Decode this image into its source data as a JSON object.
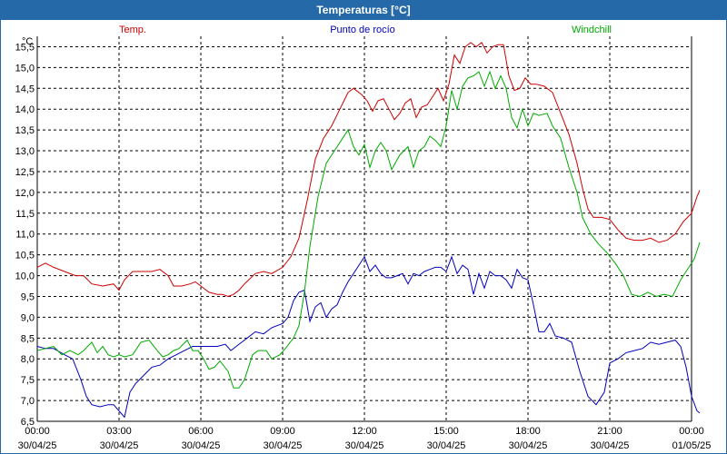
{
  "window": {
    "title": "Temperaturas [°C]"
  },
  "chart_data": {
    "type": "line",
    "title": "Temperaturas [°C]",
    "ylabel": "°C",
    "ylim": [
      6.5,
      15.75
    ],
    "yticks": [
      "15,5",
      "15,0",
      "14,5",
      "14,0",
      "13,5",
      "13,0",
      "12,5",
      "12,0",
      "11,5",
      "11,0",
      "10,5",
      "10,0",
      "9,5",
      "9,0",
      "8,5",
      "8,0",
      "7,5",
      "7,0",
      "6,5"
    ],
    "ytick_values": [
      15.5,
      15.0,
      14.5,
      14.0,
      13.5,
      13.0,
      12.5,
      12.0,
      11.5,
      11.0,
      10.5,
      10.0,
      9.5,
      9.0,
      8.5,
      8.0,
      7.5,
      7.0,
      6.5
    ],
    "xlim_hours": [
      0,
      24
    ],
    "xticks": [
      {
        "time": "00:00",
        "date": "30/04/25",
        "h": 0
      },
      {
        "time": "03:00",
        "date": "30/04/25",
        "h": 3
      },
      {
        "time": "06:00",
        "date": "30/04/25",
        "h": 6
      },
      {
        "time": "09:00",
        "date": "30/04/25",
        "h": 9
      },
      {
        "time": "12:00",
        "date": "30/04/25",
        "h": 12
      },
      {
        "time": "15:00",
        "date": "30/04/25",
        "h": 15
      },
      {
        "time": "18:00",
        "date": "30/04/25",
        "h": 18
      },
      {
        "time": "21:00",
        "date": "30/04/25",
        "h": 21
      },
      {
        "time": "00:00",
        "date": "01/05/25",
        "h": 24
      }
    ],
    "grid": true,
    "series": [
      {
        "name": "Temp.",
        "color": "#cc0000",
        "points": [
          [
            0,
            10.2
          ],
          [
            0.3,
            10.3
          ],
          [
            0.6,
            10.2
          ],
          [
            1.0,
            10.1
          ],
          [
            1.4,
            10.0
          ],
          [
            1.7,
            10.0
          ],
          [
            2.0,
            9.8
          ],
          [
            2.4,
            9.75
          ],
          [
            2.8,
            9.8
          ],
          [
            3.0,
            9.65
          ],
          [
            3.2,
            9.9
          ],
          [
            3.5,
            10.1
          ],
          [
            3.8,
            10.1
          ],
          [
            4.2,
            10.1
          ],
          [
            4.5,
            10.15
          ],
          [
            4.8,
            10.0
          ],
          [
            5.0,
            9.75
          ],
          [
            5.3,
            9.75
          ],
          [
            5.6,
            9.8
          ],
          [
            5.8,
            9.85
          ],
          [
            6.0,
            9.75
          ],
          [
            6.3,
            9.6
          ],
          [
            6.6,
            9.55
          ],
          [
            6.8,
            9.55
          ],
          [
            7.0,
            9.5
          ],
          [
            7.2,
            9.55
          ],
          [
            7.4,
            9.65
          ],
          [
            7.6,
            9.8
          ],
          [
            8.0,
            10.05
          ],
          [
            8.3,
            10.1
          ],
          [
            8.6,
            10.05
          ],
          [
            9.0,
            10.2
          ],
          [
            9.3,
            10.45
          ],
          [
            9.6,
            10.9
          ],
          [
            9.9,
            11.8
          ],
          [
            10.2,
            12.8
          ],
          [
            10.5,
            13.3
          ],
          [
            10.8,
            13.6
          ],
          [
            11.1,
            14.0
          ],
          [
            11.4,
            14.4
          ],
          [
            11.6,
            14.5
          ],
          [
            11.9,
            14.35
          ],
          [
            12.1,
            14.2
          ],
          [
            12.3,
            13.95
          ],
          [
            12.5,
            14.2
          ],
          [
            12.7,
            14.25
          ],
          [
            12.9,
            14.0
          ],
          [
            13.1,
            13.75
          ],
          [
            13.3,
            13.9
          ],
          [
            13.5,
            14.15
          ],
          [
            13.7,
            14.25
          ],
          [
            13.9,
            13.8
          ],
          [
            14.1,
            14.05
          ],
          [
            14.3,
            14.1
          ],
          [
            14.5,
            14.3
          ],
          [
            14.7,
            14.5
          ],
          [
            14.9,
            14.2
          ],
          [
            15.1,
            14.6
          ],
          [
            15.3,
            15.3
          ],
          [
            15.5,
            15.1
          ],
          [
            15.7,
            15.5
          ],
          [
            15.9,
            15.6
          ],
          [
            16.1,
            15.5
          ],
          [
            16.3,
            15.6
          ],
          [
            16.5,
            15.35
          ],
          [
            16.7,
            15.5
          ],
          [
            16.9,
            15.55
          ],
          [
            17.1,
            15.55
          ],
          [
            17.3,
            14.8
          ],
          [
            17.5,
            14.45
          ],
          [
            17.7,
            14.5
          ],
          [
            17.9,
            14.75
          ],
          [
            18.1,
            14.6
          ],
          [
            18.3,
            14.6
          ],
          [
            18.6,
            14.55
          ],
          [
            18.9,
            14.4
          ],
          [
            19.2,
            13.9
          ],
          [
            19.5,
            13.4
          ],
          [
            19.8,
            12.7
          ],
          [
            20.0,
            12.1
          ],
          [
            20.2,
            11.6
          ],
          [
            20.4,
            11.4
          ],
          [
            20.7,
            11.4
          ],
          [
            21.0,
            11.35
          ],
          [
            21.3,
            11.1
          ],
          [
            21.6,
            10.9
          ],
          [
            21.9,
            10.85
          ],
          [
            22.2,
            10.85
          ],
          [
            22.5,
            10.9
          ],
          [
            22.8,
            10.8
          ],
          [
            23.1,
            10.85
          ],
          [
            23.4,
            11.0
          ],
          [
            23.7,
            11.3
          ],
          [
            24.0,
            11.5
          ],
          [
            24.2,
            11.9
          ],
          [
            24.3,
            12.05
          ]
        ]
      },
      {
        "name": "Punto de rocío",
        "color": "#0000bb",
        "points": [
          [
            0,
            8.3
          ],
          [
            0.3,
            8.25
          ],
          [
            0.6,
            8.25
          ],
          [
            1.0,
            8.1
          ],
          [
            1.3,
            8.0
          ],
          [
            1.6,
            7.5
          ],
          [
            1.8,
            7.1
          ],
          [
            2.0,
            6.9
          ],
          [
            2.3,
            6.85
          ],
          [
            2.6,
            6.9
          ],
          [
            2.8,
            6.9
          ],
          [
            3.0,
            6.75
          ],
          [
            3.2,
            6.6
          ],
          [
            3.4,
            7.2
          ],
          [
            3.6,
            7.4
          ],
          [
            3.9,
            7.6
          ],
          [
            4.2,
            7.8
          ],
          [
            4.5,
            7.85
          ],
          [
            4.8,
            8.0
          ],
          [
            5.1,
            8.1
          ],
          [
            5.4,
            8.2
          ],
          [
            5.7,
            8.3
          ],
          [
            6.0,
            8.3
          ],
          [
            6.3,
            8.3
          ],
          [
            6.6,
            8.3
          ],
          [
            6.9,
            8.35
          ],
          [
            7.1,
            8.2
          ],
          [
            7.3,
            8.3
          ],
          [
            7.5,
            8.4
          ],
          [
            7.7,
            8.5
          ],
          [
            8.0,
            8.65
          ],
          [
            8.3,
            8.6
          ],
          [
            8.6,
            8.75
          ],
          [
            9.0,
            8.85
          ],
          [
            9.2,
            9.0
          ],
          [
            9.4,
            9.4
          ],
          [
            9.6,
            9.6
          ],
          [
            9.8,
            9.65
          ],
          [
            10.0,
            8.9
          ],
          [
            10.2,
            9.25
          ],
          [
            10.4,
            9.35
          ],
          [
            10.6,
            9.0
          ],
          [
            10.8,
            9.2
          ],
          [
            11.0,
            9.3
          ],
          [
            11.2,
            9.6
          ],
          [
            11.4,
            9.85
          ],
          [
            11.6,
            10.05
          ],
          [
            11.8,
            10.25
          ],
          [
            12.0,
            10.45
          ],
          [
            12.2,
            10.1
          ],
          [
            12.4,
            10.25
          ],
          [
            12.6,
            10.05
          ],
          [
            12.8,
            9.95
          ],
          [
            13.0,
            9.95
          ],
          [
            13.2,
            10.0
          ],
          [
            13.4,
            10.05
          ],
          [
            13.6,
            9.8
          ],
          [
            13.8,
            10.05
          ],
          [
            14.0,
            10.0
          ],
          [
            14.2,
            10.1
          ],
          [
            14.4,
            10.15
          ],
          [
            14.6,
            10.2
          ],
          [
            14.8,
            10.2
          ],
          [
            15.0,
            10.1
          ],
          [
            15.2,
            10.45
          ],
          [
            15.4,
            10.05
          ],
          [
            15.6,
            10.25
          ],
          [
            15.8,
            10.15
          ],
          [
            16.0,
            9.55
          ],
          [
            16.2,
            10.05
          ],
          [
            16.4,
            9.7
          ],
          [
            16.6,
            10.1
          ],
          [
            16.8,
            10.0
          ],
          [
            17.0,
            10.0
          ],
          [
            17.2,
            9.9
          ],
          [
            17.4,
            9.7
          ],
          [
            17.6,
            10.15
          ],
          [
            17.8,
            9.95
          ],
          [
            18.0,
            9.9
          ],
          [
            18.2,
            9.3
          ],
          [
            18.4,
            8.65
          ],
          [
            18.6,
            8.65
          ],
          [
            18.8,
            8.85
          ],
          [
            19.0,
            8.55
          ],
          [
            19.3,
            8.5
          ],
          [
            19.6,
            8.4
          ],
          [
            19.9,
            7.7
          ],
          [
            20.2,
            7.1
          ],
          [
            20.5,
            6.9
          ],
          [
            20.8,
            7.2
          ],
          [
            21.0,
            7.9
          ],
          [
            21.3,
            8.0
          ],
          [
            21.6,
            8.15
          ],
          [
            21.9,
            8.2
          ],
          [
            22.2,
            8.25
          ],
          [
            22.5,
            8.4
          ],
          [
            22.8,
            8.35
          ],
          [
            23.1,
            8.4
          ],
          [
            23.4,
            8.45
          ],
          [
            23.6,
            8.3
          ],
          [
            23.8,
            7.8
          ],
          [
            24.0,
            7.1
          ],
          [
            24.2,
            6.75
          ],
          [
            24.3,
            6.7
          ]
        ]
      },
      {
        "name": "Windchill",
        "color": "#00aa00",
        "points": [
          [
            0,
            8.2
          ],
          [
            0.3,
            8.25
          ],
          [
            0.6,
            8.3
          ],
          [
            0.9,
            8.1
          ],
          [
            1.2,
            8.2
          ],
          [
            1.5,
            8.1
          ],
          [
            1.7,
            8.2
          ],
          [
            2.0,
            8.4
          ],
          [
            2.2,
            8.15
          ],
          [
            2.4,
            8.3
          ],
          [
            2.6,
            8.1
          ],
          [
            2.8,
            8.05
          ],
          [
            3.0,
            8.1
          ],
          [
            3.2,
            8.05
          ],
          [
            3.5,
            8.1
          ],
          [
            3.8,
            8.4
          ],
          [
            4.1,
            8.45
          ],
          [
            4.4,
            8.2
          ],
          [
            4.6,
            8.05
          ],
          [
            4.8,
            8.1
          ],
          [
            5.0,
            8.2
          ],
          [
            5.2,
            8.25
          ],
          [
            5.5,
            8.45
          ],
          [
            5.7,
            8.2
          ],
          [
            5.9,
            8.2
          ],
          [
            6.1,
            8.0
          ],
          [
            6.3,
            7.75
          ],
          [
            6.5,
            7.8
          ],
          [
            6.7,
            7.95
          ],
          [
            7.0,
            7.7
          ],
          [
            7.2,
            7.3
          ],
          [
            7.4,
            7.3
          ],
          [
            7.6,
            7.5
          ],
          [
            7.9,
            8.1
          ],
          [
            8.1,
            8.2
          ],
          [
            8.4,
            8.2
          ],
          [
            8.6,
            8.0
          ],
          [
            8.9,
            8.1
          ],
          [
            9.1,
            8.25
          ],
          [
            9.4,
            8.5
          ],
          [
            9.6,
            8.8
          ],
          [
            9.8,
            9.6
          ],
          [
            10.0,
            10.7
          ],
          [
            10.3,
            11.9
          ],
          [
            10.6,
            12.7
          ],
          [
            10.9,
            13.0
          ],
          [
            11.2,
            13.3
          ],
          [
            11.4,
            13.5
          ],
          [
            11.6,
            13.1
          ],
          [
            11.8,
            12.9
          ],
          [
            12.0,
            13.15
          ],
          [
            12.2,
            12.6
          ],
          [
            12.4,
            13.0
          ],
          [
            12.6,
            13.2
          ],
          [
            12.8,
            13.0
          ],
          [
            13.0,
            12.55
          ],
          [
            13.3,
            12.9
          ],
          [
            13.6,
            13.1
          ],
          [
            13.8,
            12.6
          ],
          [
            14.0,
            13.0
          ],
          [
            14.2,
            13.1
          ],
          [
            14.4,
            13.35
          ],
          [
            14.6,
            13.25
          ],
          [
            14.8,
            13.1
          ],
          [
            15.0,
            13.6
          ],
          [
            15.2,
            14.45
          ],
          [
            15.4,
            14.0
          ],
          [
            15.6,
            14.55
          ],
          [
            15.8,
            14.75
          ],
          [
            16.0,
            14.8
          ],
          [
            16.2,
            14.9
          ],
          [
            16.4,
            14.55
          ],
          [
            16.6,
            14.9
          ],
          [
            16.8,
            14.5
          ],
          [
            17.0,
            14.8
          ],
          [
            17.2,
            14.5
          ],
          [
            17.4,
            13.8
          ],
          [
            17.6,
            13.55
          ],
          [
            17.8,
            14.0
          ],
          [
            18.0,
            13.6
          ],
          [
            18.2,
            13.9
          ],
          [
            18.4,
            13.85
          ],
          [
            18.7,
            13.9
          ],
          [
            18.9,
            13.6
          ],
          [
            19.2,
            13.3
          ],
          [
            19.5,
            12.6
          ],
          [
            19.8,
            12.0
          ],
          [
            20.0,
            11.4
          ],
          [
            20.3,
            11.0
          ],
          [
            20.6,
            10.75
          ],
          [
            20.9,
            10.55
          ],
          [
            21.2,
            10.3
          ],
          [
            21.5,
            10.0
          ],
          [
            21.8,
            9.55
          ],
          [
            22.1,
            9.5
          ],
          [
            22.4,
            9.6
          ],
          [
            22.7,
            9.5
          ],
          [
            23.0,
            9.55
          ],
          [
            23.3,
            9.5
          ],
          [
            23.6,
            9.9
          ],
          [
            23.9,
            10.2
          ],
          [
            24.1,
            10.4
          ],
          [
            24.3,
            10.8
          ]
        ]
      }
    ]
  }
}
